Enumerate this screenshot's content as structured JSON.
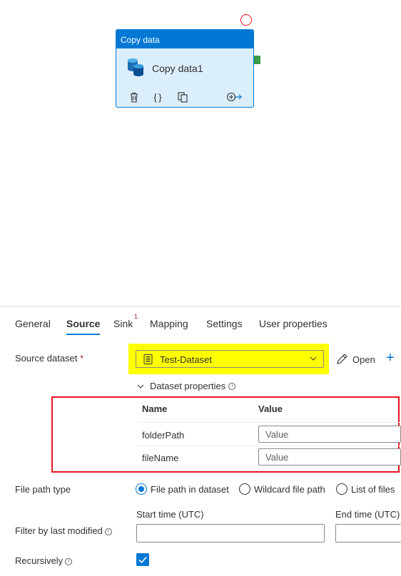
{
  "canvas": {
    "activity": {
      "type_label": "Copy data",
      "name": "Copy data1",
      "actions": [
        "delete-icon",
        "code-icon",
        "clone-icon",
        "add-output-icon"
      ]
    }
  },
  "tabs": {
    "items": [
      {
        "label": "General"
      },
      {
        "label": "Source"
      },
      {
        "label": "Sink",
        "badge": "1"
      },
      {
        "label": "Mapping"
      },
      {
        "label": "Settings"
      },
      {
        "label": "User properties"
      }
    ],
    "active": "Source"
  },
  "source": {
    "dataset_label": "Source dataset",
    "required_mark": "*",
    "dataset_value": "Test-Dataset",
    "open_label": "Open",
    "new_icon": "+",
    "dataset_properties_label": "Dataset properties",
    "properties_table": {
      "headers": {
        "name": "Name",
        "value": "Value"
      },
      "rows": [
        {
          "name": "folderPath",
          "placeholder": "Value"
        },
        {
          "name": "fileName",
          "placeholder": "Value"
        }
      ]
    },
    "file_path_type_label": "File path type",
    "file_path_options": [
      {
        "label": "File path in dataset",
        "checked": true
      },
      {
        "label": "Wildcard file path",
        "checked": false
      },
      {
        "label": "List of files",
        "checked": false
      }
    ],
    "start_time_label": "Start time (UTC)",
    "end_time_label": "End time (UTC)",
    "filter_label": "Filter by last modified",
    "recursively_label": "Recursively",
    "recursively_checked": true
  },
  "colors": {
    "accent": "#0078d4",
    "highlight_yellow": "#ffff00",
    "highlight_red": "#e81123",
    "success_green": "#3c9a48"
  }
}
